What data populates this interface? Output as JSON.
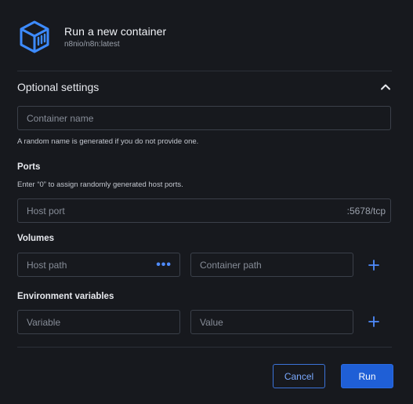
{
  "header": {
    "title": "Run a new container",
    "subtitle": "n8nio/n8n:latest",
    "logo_icon": "container-box-icon"
  },
  "optional_settings": {
    "title": "Optional settings",
    "expanded": true,
    "container_name": {
      "placeholder": "Container name",
      "value": "",
      "helper": "A random name is generated if you do not provide one."
    },
    "ports": {
      "label": "Ports",
      "helper": "Enter “0” to assign randomly generated host ports.",
      "host_port_placeholder": "Host port",
      "suffix": ":5678/tcp"
    },
    "volumes": {
      "label": "Volumes",
      "host_path_placeholder": "Host path",
      "browse_icon": "more-horizontal-icon",
      "container_path_placeholder": "Container path",
      "add_icon": "plus-icon"
    },
    "env": {
      "label": "Environment variables",
      "variable_placeholder": "Variable",
      "value_placeholder": "Value",
      "add_icon": "plus-icon"
    }
  },
  "footer": {
    "cancel_label": "Cancel",
    "run_label": "Run"
  },
  "colors": {
    "background": "#17191e",
    "accent": "#1f5fd6",
    "accent_text": "#4f8cff",
    "border": "#3b404a"
  }
}
